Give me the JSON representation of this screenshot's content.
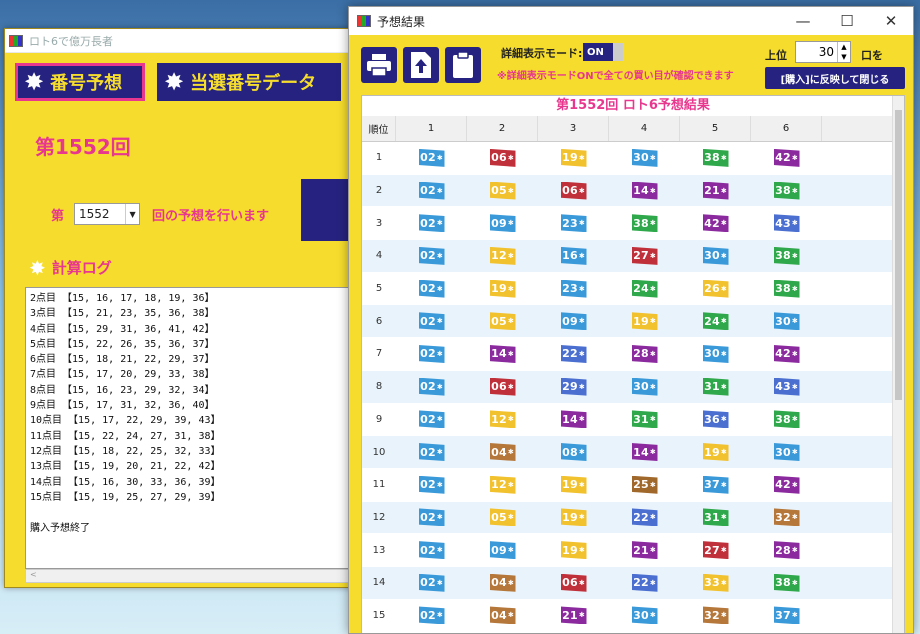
{
  "back_window": {
    "title": "ロト6で億万長者",
    "tab1": "番号予想",
    "tab2": "当選番号データ",
    "draw_title": "第1552回",
    "prefix": "第",
    "draw_select_value": "1552",
    "suffix": "回の予想を行います",
    "log_title": "計算ログ",
    "log_lines": [
      "2点目 【15, 16, 17, 18, 19, 36】",
      "3点目 【15, 21, 23, 35, 36, 38】",
      "4点目 【15, 29, 31, 36, 41, 42】",
      "5点目 【15, 22, 26, 35, 36, 37】",
      "6点目 【15, 18, 21, 22, 29, 37】",
      "7点目 【15, 17, 20, 29, 33, 38】",
      "8点目 【15, 16, 23, 29, 32, 34】",
      "9点目 【15, 17, 31, 32, 36, 40】",
      "10点目 【15, 17, 22, 29, 39, 43】",
      "11点目 【15, 22, 24, 27, 31, 38】",
      "12点目 【15, 18, 22, 25, 32, 33】",
      "13点目 【15, 19, 20, 21, 22, 42】",
      "14点目 【15, 16, 30, 33, 36, 39】",
      "15点目 【15, 19, 25, 27, 29, 39】"
    ],
    "log_end": "購入予想終了",
    "scroll_arrow": "<"
  },
  "front_window": {
    "title": "予想結果",
    "detail_mode_label": "詳細表示モード:",
    "toggle_value": "ON",
    "note": "※詳細表示モードONで全ての買い目が確認できます",
    "rank_label": "上位",
    "rank_count": "30",
    "rank_unit": "口を",
    "apply_button": "[購入]に反映して閉じる",
    "grid_title": "第1552回 ロト6予想結果",
    "columns": [
      "順位",
      "1",
      "2",
      "3",
      "4",
      "5",
      "6"
    ],
    "rows": [
      {
        "rank": "1",
        "nums": [
          "02",
          "06",
          "19",
          "30",
          "38",
          "42"
        ]
      },
      {
        "rank": "2",
        "nums": [
          "02",
          "05",
          "06",
          "14",
          "21",
          "38"
        ]
      },
      {
        "rank": "3",
        "nums": [
          "02",
          "09",
          "23",
          "38",
          "42",
          "43"
        ]
      },
      {
        "rank": "4",
        "nums": [
          "02",
          "12",
          "16",
          "27",
          "30",
          "38"
        ]
      },
      {
        "rank": "5",
        "nums": [
          "02",
          "19",
          "23",
          "24",
          "26",
          "38"
        ]
      },
      {
        "rank": "6",
        "nums": [
          "02",
          "05",
          "09",
          "19",
          "24",
          "30"
        ]
      },
      {
        "rank": "7",
        "nums": [
          "02",
          "14",
          "22",
          "28",
          "30",
          "42"
        ]
      },
      {
        "rank": "8",
        "nums": [
          "02",
          "06",
          "29",
          "30",
          "31",
          "43"
        ]
      },
      {
        "rank": "9",
        "nums": [
          "02",
          "12",
          "14",
          "31",
          "36",
          "38"
        ]
      },
      {
        "rank": "10",
        "nums": [
          "02",
          "04",
          "08",
          "14",
          "19",
          "30"
        ]
      },
      {
        "rank": "11",
        "nums": [
          "02",
          "12",
          "19",
          "25",
          "37",
          "42"
        ]
      },
      {
        "rank": "12",
        "nums": [
          "02",
          "05",
          "19",
          "22",
          "31",
          "32"
        ]
      },
      {
        "rank": "13",
        "nums": [
          "02",
          "09",
          "19",
          "21",
          "27",
          "28"
        ]
      },
      {
        "rank": "14",
        "nums": [
          "02",
          "04",
          "06",
          "22",
          "33",
          "38"
        ]
      },
      {
        "rank": "15",
        "nums": [
          "02",
          "04",
          "21",
          "30",
          "32",
          "37"
        ]
      }
    ]
  },
  "colors": {
    "yellow": "#f6dd2d",
    "navy": "#25237f",
    "pink": "#e8378e",
    "ball_colors": {
      "02": "#3a9ad9",
      "04": "#b5773a",
      "05": "#f2c12e",
      "06": "#c0303a",
      "08": "#3a9ad9",
      "09": "#3a9ad9",
      "12": "#f2c12e",
      "14": "#8b2a9e",
      "16": "#3a9ad9",
      "19": "#f2c12e",
      "21": "#8b2a9e",
      "22": "#4a6fd0",
      "23": "#3a9ad9",
      "24": "#2ea84a",
      "25": "#a0682a",
      "26": "#f2c12e",
      "27": "#c0303a",
      "28": "#8b2a9e",
      "29": "#4a6fd0",
      "30": "#3a9ad9",
      "31": "#2ea84a",
      "32": "#b5773a",
      "33": "#f2c12e",
      "36": "#4a6fd0",
      "37": "#3a9ad9",
      "38": "#2ea84a",
      "42": "#8b2a9e",
      "43": "#4a6fd0"
    }
  }
}
